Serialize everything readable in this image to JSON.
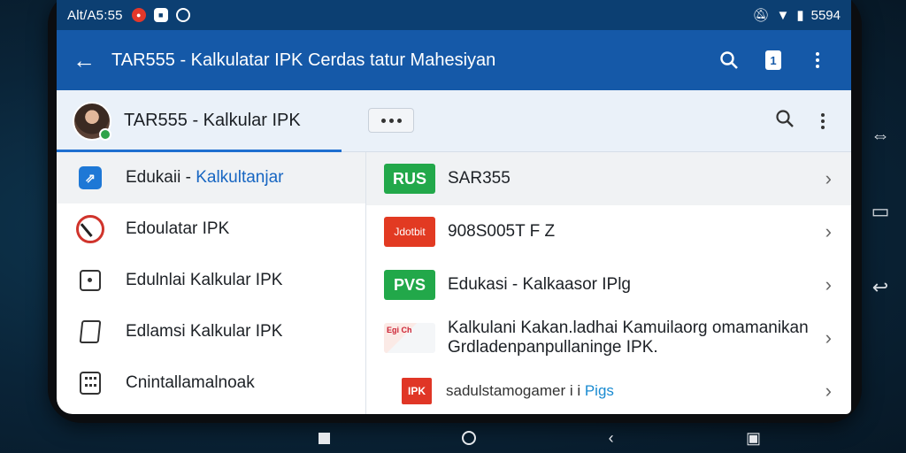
{
  "status_bar": {
    "time": "Alt/A5:55",
    "right_text": "5594",
    "icons": [
      "notification-red-icon",
      "media-icon",
      "app-icon",
      "silent-icon",
      "wifi-icon",
      "battery-icon"
    ]
  },
  "app_bar": {
    "title": "TAR555 - Kalkulatar IPK Cerdas tatur Mahesiyan",
    "icons": [
      "back-arrow-icon",
      "search-icon",
      "document-icon",
      "more-vert-icon"
    ]
  },
  "sub_header": {
    "title": "TAR555 - Kalkular IPK",
    "icons": [
      "more-horizontal-icon",
      "search-icon",
      "more-vert-icon"
    ]
  },
  "left_list": [
    {
      "label_main": "Edukaii - ",
      "label_highlight": "Kalkultanjar",
      "icon": "app-blue-icon",
      "active": true
    },
    {
      "label_main": "Edoulatar IPK",
      "label_highlight": "",
      "icon": "clock-icon"
    },
    {
      "label_main": "Edulnlai Kalkular IPK",
      "label_highlight": "",
      "icon": "square-dot-icon"
    },
    {
      "label_main": "Edlamsi Kalkular IPK",
      "label_highlight": "",
      "icon": "share-icon"
    },
    {
      "label_main": "Cnintallamalnoak",
      "label_highlight": "",
      "icon": "calculator-icon"
    }
  ],
  "right_list": [
    {
      "badge": "RUS",
      "badge_style": "green",
      "text": "SAR355",
      "active": true
    },
    {
      "badge": "Jdotbit",
      "badge_style": "red",
      "text": "908S005T F  Z"
    },
    {
      "badge": "PVS",
      "badge_style": "green",
      "text": "Edukasi - Kalkaasor IPlg"
    },
    {
      "badge": "Egi Ch",
      "badge_style": "thumb",
      "text": "Kalkulani Kakan.ladhai Kamuilaorg omamanikan Grdladenpanpullaninge IPK."
    },
    {
      "badge": "IPK",
      "badge_style": "small-red",
      "text_main": "sadulstamogamer i i ",
      "text_highlight": "Pigs"
    }
  ],
  "colors": {
    "status_bar": "#0c3f72",
    "app_bar": "#1559a8",
    "accent": "#1f6fd0",
    "green_badge": "#22a84a",
    "red_badge": "#e23a22"
  }
}
